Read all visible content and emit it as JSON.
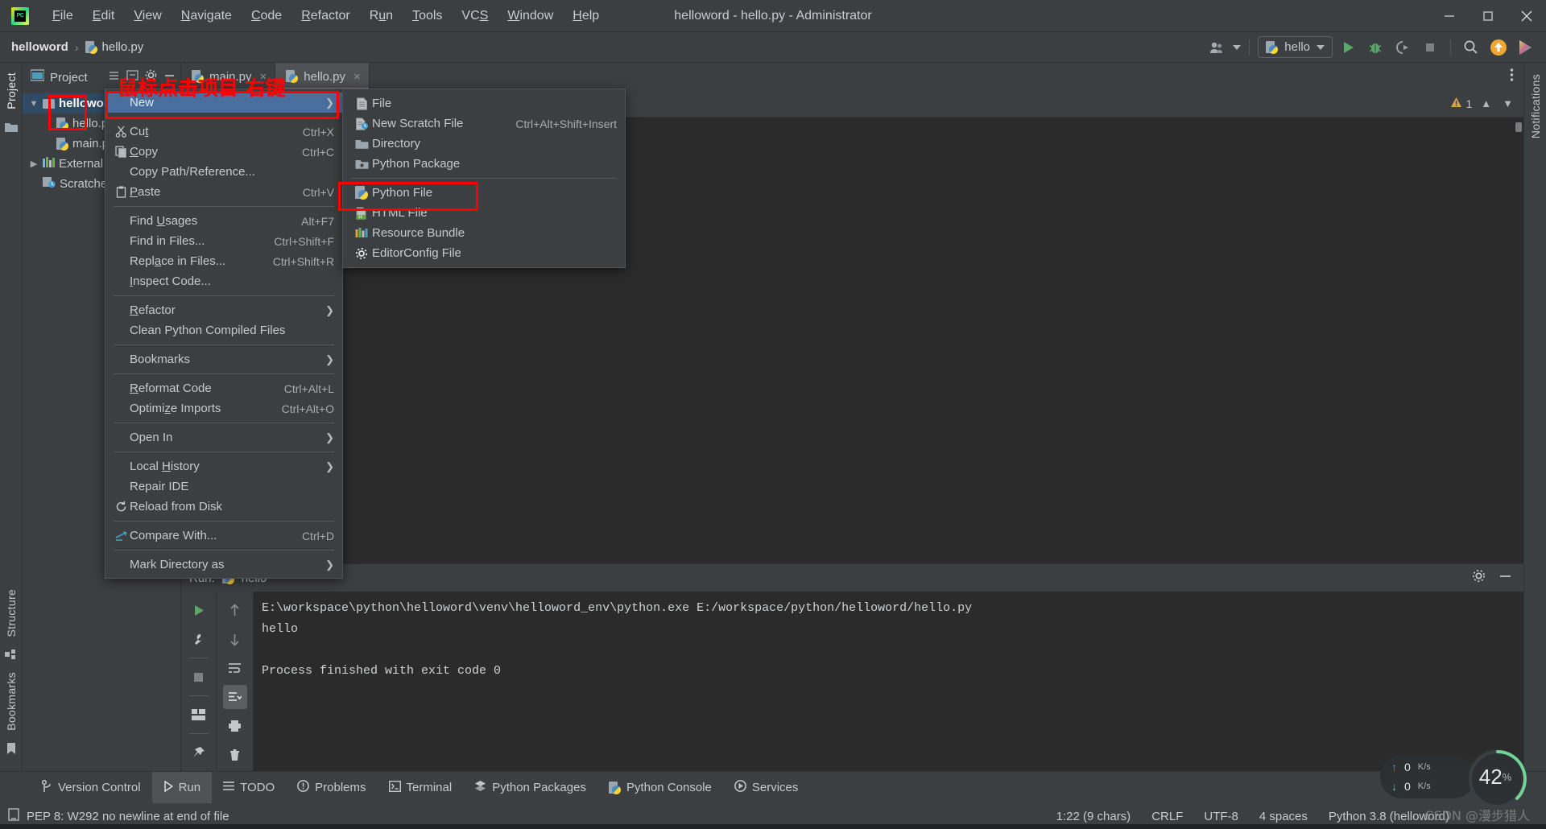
{
  "window": {
    "title": "helloword - hello.py - Administrator",
    "app_logo": "pycharm-logo"
  },
  "menubar": [
    {
      "label": "File",
      "mnemonic": "F"
    },
    {
      "label": "Edit",
      "mnemonic": "E"
    },
    {
      "label": "View",
      "mnemonic": "V"
    },
    {
      "label": "Navigate",
      "mnemonic": "N"
    },
    {
      "label": "Code",
      "mnemonic": "C"
    },
    {
      "label": "Refactor",
      "mnemonic": "R"
    },
    {
      "label": "Run",
      "mnemonic": "u"
    },
    {
      "label": "Tools",
      "mnemonic": "T"
    },
    {
      "label": "VCS",
      "mnemonic": "S"
    },
    {
      "label": "Window",
      "mnemonic": "W"
    },
    {
      "label": "Help",
      "mnemonic": "H"
    }
  ],
  "window_buttons": [
    "minimize",
    "maximize",
    "close"
  ],
  "breadcrumb": {
    "project": "helloword",
    "separator": "›",
    "file": "hello.py"
  },
  "toolbar": {
    "account_icon": "user-account-icon",
    "run_config": "hello",
    "run_icon": "run-play-icon",
    "debug_icon": "debug-bug-icon",
    "coverage_icon": "run-coverage-icon",
    "stop_icon": "stop-square-icon",
    "search_icon": "search-icon",
    "update_icon": "update-arrow-icon",
    "ide_icon": "ide-feature-icon"
  },
  "left_strip": {
    "project_label": "Project",
    "structure_label": "Structure",
    "bookmarks_label": "Bookmarks"
  },
  "right_strip": {
    "notifications_label": "Notifications"
  },
  "project_pane": {
    "title": "Project",
    "header_icons": [
      "project-view-icon",
      "collapse-all-icon",
      "select-opened-file-icon",
      "settings-gear-icon",
      "hide-icon"
    ],
    "tree": [
      {
        "label": "helloword",
        "type": "folder",
        "expanded": true,
        "selected": true,
        "depth": 0,
        "suffix": ""
      },
      {
        "label": "hello.py",
        "type": "python-file",
        "depth": 1
      },
      {
        "label": "main.py",
        "type": "python-file",
        "depth": 1
      },
      {
        "label": "External Libraries",
        "type": "libraries",
        "expanded": false,
        "depth": 0
      },
      {
        "label": "Scratches and Consoles",
        "type": "scratches",
        "depth": 0
      }
    ]
  },
  "editor": {
    "tabs": [
      {
        "label": "main.py",
        "icon": "python-file-icon",
        "active": false,
        "close": "×"
      },
      {
        "label": "hello.py",
        "icon": "python-file-icon",
        "active": true,
        "close": "×"
      }
    ],
    "inspection_warning_count": "1",
    "warning_icon": "warning-triangle-icon",
    "up_icon": "chevron-up-icon",
    "down_icon": "chevron-down-icon",
    "more_icon": "more-vertical-icon"
  },
  "context_menu": {
    "items": [
      {
        "label": "New",
        "icon": "",
        "shortcut": "",
        "submenu": true,
        "highlighted": true
      },
      {
        "sep": true
      },
      {
        "label": "Cut",
        "icon": "scissors-icon",
        "shortcut": "Ctrl+X",
        "mnemonic": "t"
      },
      {
        "label": "Copy",
        "icon": "copy-icon",
        "shortcut": "Ctrl+C",
        "mnemonic": "C"
      },
      {
        "label": "Copy Path/Reference...",
        "icon": "",
        "shortcut": ""
      },
      {
        "label": "Paste",
        "icon": "paste-clipboard-icon",
        "shortcut": "Ctrl+V",
        "mnemonic": "P"
      },
      {
        "sep": true
      },
      {
        "label": "Find Usages",
        "icon": "",
        "shortcut": "Alt+F7",
        "mnemonic": "U"
      },
      {
        "label": "Find in Files...",
        "icon": "",
        "shortcut": "Ctrl+Shift+F"
      },
      {
        "label": "Replace in Files...",
        "icon": "",
        "shortcut": "Ctrl+Shift+R",
        "mnemonic": "a"
      },
      {
        "label": "Inspect Code...",
        "icon": "",
        "shortcut": "",
        "mnemonic": "I"
      },
      {
        "sep": true
      },
      {
        "label": "Refactor",
        "icon": "",
        "shortcut": "",
        "submenu": true,
        "mnemonic": "R"
      },
      {
        "label": "Clean Python Compiled Files",
        "icon": "",
        "shortcut": ""
      },
      {
        "sep": true
      },
      {
        "label": "Bookmarks",
        "icon": "",
        "shortcut": "",
        "submenu": true
      },
      {
        "sep": true
      },
      {
        "label": "Reformat Code",
        "icon": "",
        "shortcut": "Ctrl+Alt+L",
        "mnemonic": "R"
      },
      {
        "label": "Optimize Imports",
        "icon": "",
        "shortcut": "Ctrl+Alt+O",
        "mnemonic": "z"
      },
      {
        "sep": true
      },
      {
        "label": "Open In",
        "icon": "",
        "shortcut": "",
        "submenu": true
      },
      {
        "sep": true
      },
      {
        "label": "Local History",
        "icon": "",
        "shortcut": "",
        "submenu": true,
        "mnemonic": "H"
      },
      {
        "label": "Repair IDE",
        "icon": "",
        "shortcut": ""
      },
      {
        "label": "Reload from Disk",
        "icon": "reload-icon",
        "shortcut": ""
      },
      {
        "sep": true
      },
      {
        "label": "Compare With...",
        "icon": "compare-icon",
        "shortcut": "Ctrl+D"
      },
      {
        "sep": true
      },
      {
        "label": "Mark Directory as",
        "icon": "",
        "shortcut": "",
        "submenu": true
      }
    ]
  },
  "new_submenu": {
    "items": [
      {
        "label": "File",
        "icon": "file-icon",
        "shortcut": ""
      },
      {
        "label": "New Scratch File",
        "icon": "scratch-file-icon",
        "shortcut": "Ctrl+Alt+Shift+Insert"
      },
      {
        "label": "Directory",
        "icon": "folder-icon",
        "shortcut": ""
      },
      {
        "label": "Python Package",
        "icon": "python-package-icon",
        "shortcut": ""
      },
      {
        "sep": true
      },
      {
        "label": "Python File",
        "icon": "python-file-icon",
        "shortcut": "",
        "boxed": true
      },
      {
        "label": "HTML File",
        "icon": "html-file-icon",
        "shortcut": ""
      },
      {
        "label": "Resource Bundle",
        "icon": "resource-bundle-icon",
        "shortcut": ""
      },
      {
        "label": "EditorConfig File",
        "icon": "editorconfig-icon",
        "shortcut": ""
      }
    ]
  },
  "annotation": {
    "text": "鼠标点击项目 右键",
    "color": "#ff0000"
  },
  "run_window": {
    "label": "Run:",
    "config_name": "hello",
    "icon": "python-file-icon",
    "settings_icon": "settings-gear-icon",
    "hide_icon": "hide-icon",
    "left_tools": [
      "rerun-play-icon",
      "wrench-icon",
      "stop-icon",
      "layout-icon",
      "pin-icon"
    ],
    "right_tools": [
      "arrow-up-icon",
      "arrow-down-icon",
      "soft-wrap-icon",
      "scroll-to-end-icon",
      "print-icon",
      "trash-icon"
    ],
    "console_lines": [
      "E:\\workspace\\python\\helloword\\venv\\helloword_env\\python.exe E:/workspace/python/helloword/hello.py",
      "hello",
      "",
      "Process finished with exit code 0"
    ]
  },
  "bottom_bar": {
    "items": [
      {
        "label": "Version Control",
        "icon": "branch-icon",
        "active": false
      },
      {
        "label": "Run",
        "icon": "play-icon",
        "active": true
      },
      {
        "label": "TODO",
        "icon": "list-icon",
        "active": false
      },
      {
        "label": "Problems",
        "icon": "exclaim-circle-icon",
        "active": false
      },
      {
        "label": "Terminal",
        "icon": "terminal-icon",
        "active": false
      },
      {
        "label": "Python Packages",
        "icon": "packages-icon",
        "active": false
      },
      {
        "label": "Python Console",
        "icon": "python-console-icon",
        "active": false
      },
      {
        "label": "Services",
        "icon": "services-icon",
        "active": false
      }
    ]
  },
  "status_bar": {
    "message_icon": "event-log-icon",
    "message": "PEP 8: W292 no newline at end of file",
    "caret": "1:22 (9 chars)",
    "line_sep": "CRLF",
    "encoding": "UTF-8",
    "indent": "4 spaces",
    "interpreter": "Python 3.8 (helloword)"
  },
  "system_widget": {
    "upload": "0",
    "upload_unit": "K/s",
    "download": "0",
    "download_unit": "K/s",
    "cpu_value": "42",
    "cpu_unit": "%",
    "up_arrow": "↑",
    "down_arrow": "↓"
  },
  "watermark": "CSDN @漫步猎人"
}
